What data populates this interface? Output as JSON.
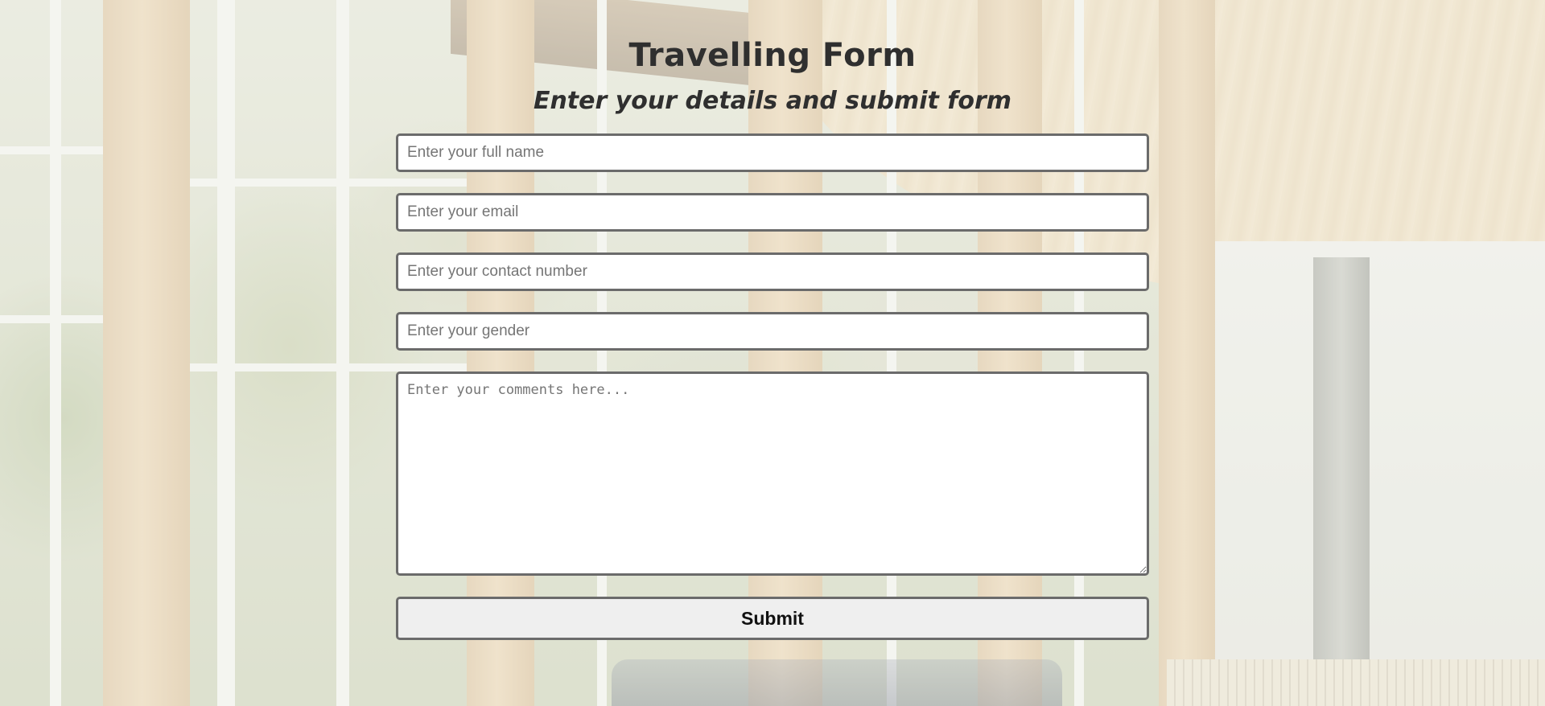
{
  "form": {
    "title": "Travelling Form",
    "subtitle": "Enter your details and submit form",
    "fields": {
      "full_name": {
        "placeholder": "Enter your full name",
        "value": ""
      },
      "email": {
        "placeholder": "Enter your email",
        "value": ""
      },
      "contact": {
        "placeholder": "Enter your contact number",
        "value": ""
      },
      "gender": {
        "placeholder": "Enter your gender",
        "value": ""
      },
      "comments": {
        "placeholder": "Enter your comments here...",
        "value": ""
      }
    },
    "submit_label": "Submit"
  },
  "background": {
    "description_icon": "library-interior-photo"
  },
  "colors": {
    "heading": "#2f2f2f",
    "field_border": "#6b6b6b",
    "field_bg": "#ffffff",
    "button_bg": "#efefef"
  }
}
